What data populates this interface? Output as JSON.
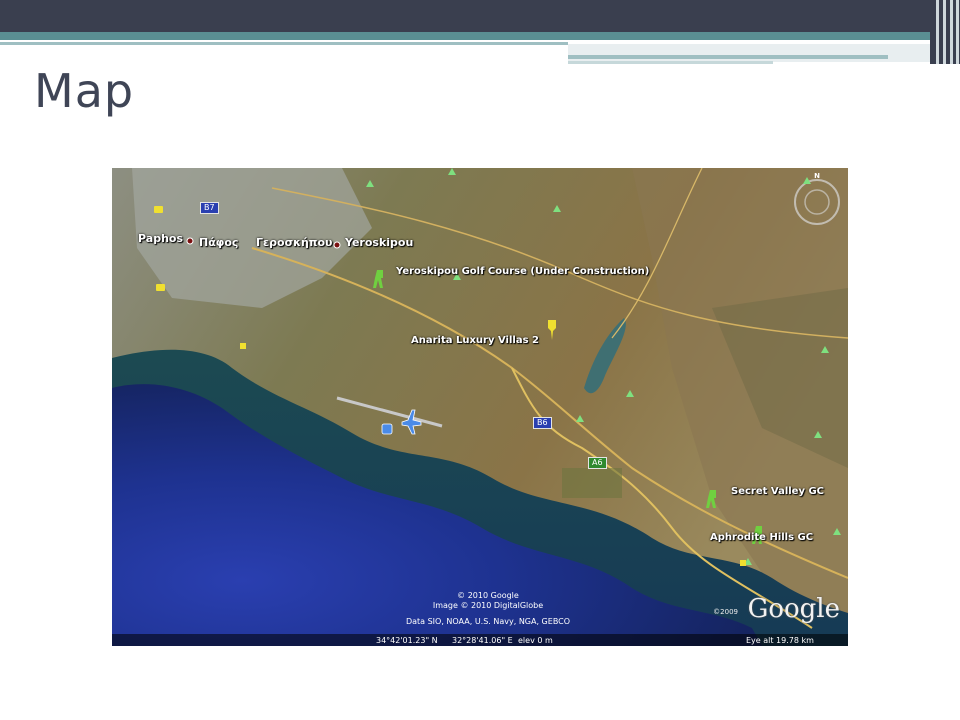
{
  "slide": {
    "title": "Map"
  },
  "map": {
    "places": {
      "paphos_en": "Paphos",
      "paphos_gr": "Πάφος",
      "yeroskipou_gr": "Γεροσκήπου",
      "yeroskipou_en": "Yeroskipou"
    },
    "pois": {
      "yeroskipou_golf": "Yeroskipou Golf Course (Under Construction)",
      "anarita": "Anarita Luxury Villas 2",
      "secret_valley": "Secret Valley GC",
      "aphrodite_hills": "Aphrodite Hills GC"
    },
    "roads": {
      "b7": "B7",
      "b6": "B6",
      "a6": "A6"
    },
    "attribution": {
      "line1": "© 2010 Google",
      "line2": "Image © 2010 DigitalGlobe",
      "line3": "Data SIO, NOAA, U.S. Navy, NGA, GEBCO"
    },
    "logo": "Google",
    "logo_year": "©2009",
    "compass_north": "N",
    "status": {
      "lat": "34°42'01.23\" N",
      "lon": "32°28'41.06\" E",
      "elev": "elev   0 m",
      "eye_alt": "Eye alt   19.78 km"
    }
  },
  "colors": {
    "header_dark": "#3a3f4f",
    "header_teal": "#5a8f93",
    "title": "#3f4556",
    "sea_deep": "#1a2e8a",
    "land": "#7a7a4c"
  }
}
